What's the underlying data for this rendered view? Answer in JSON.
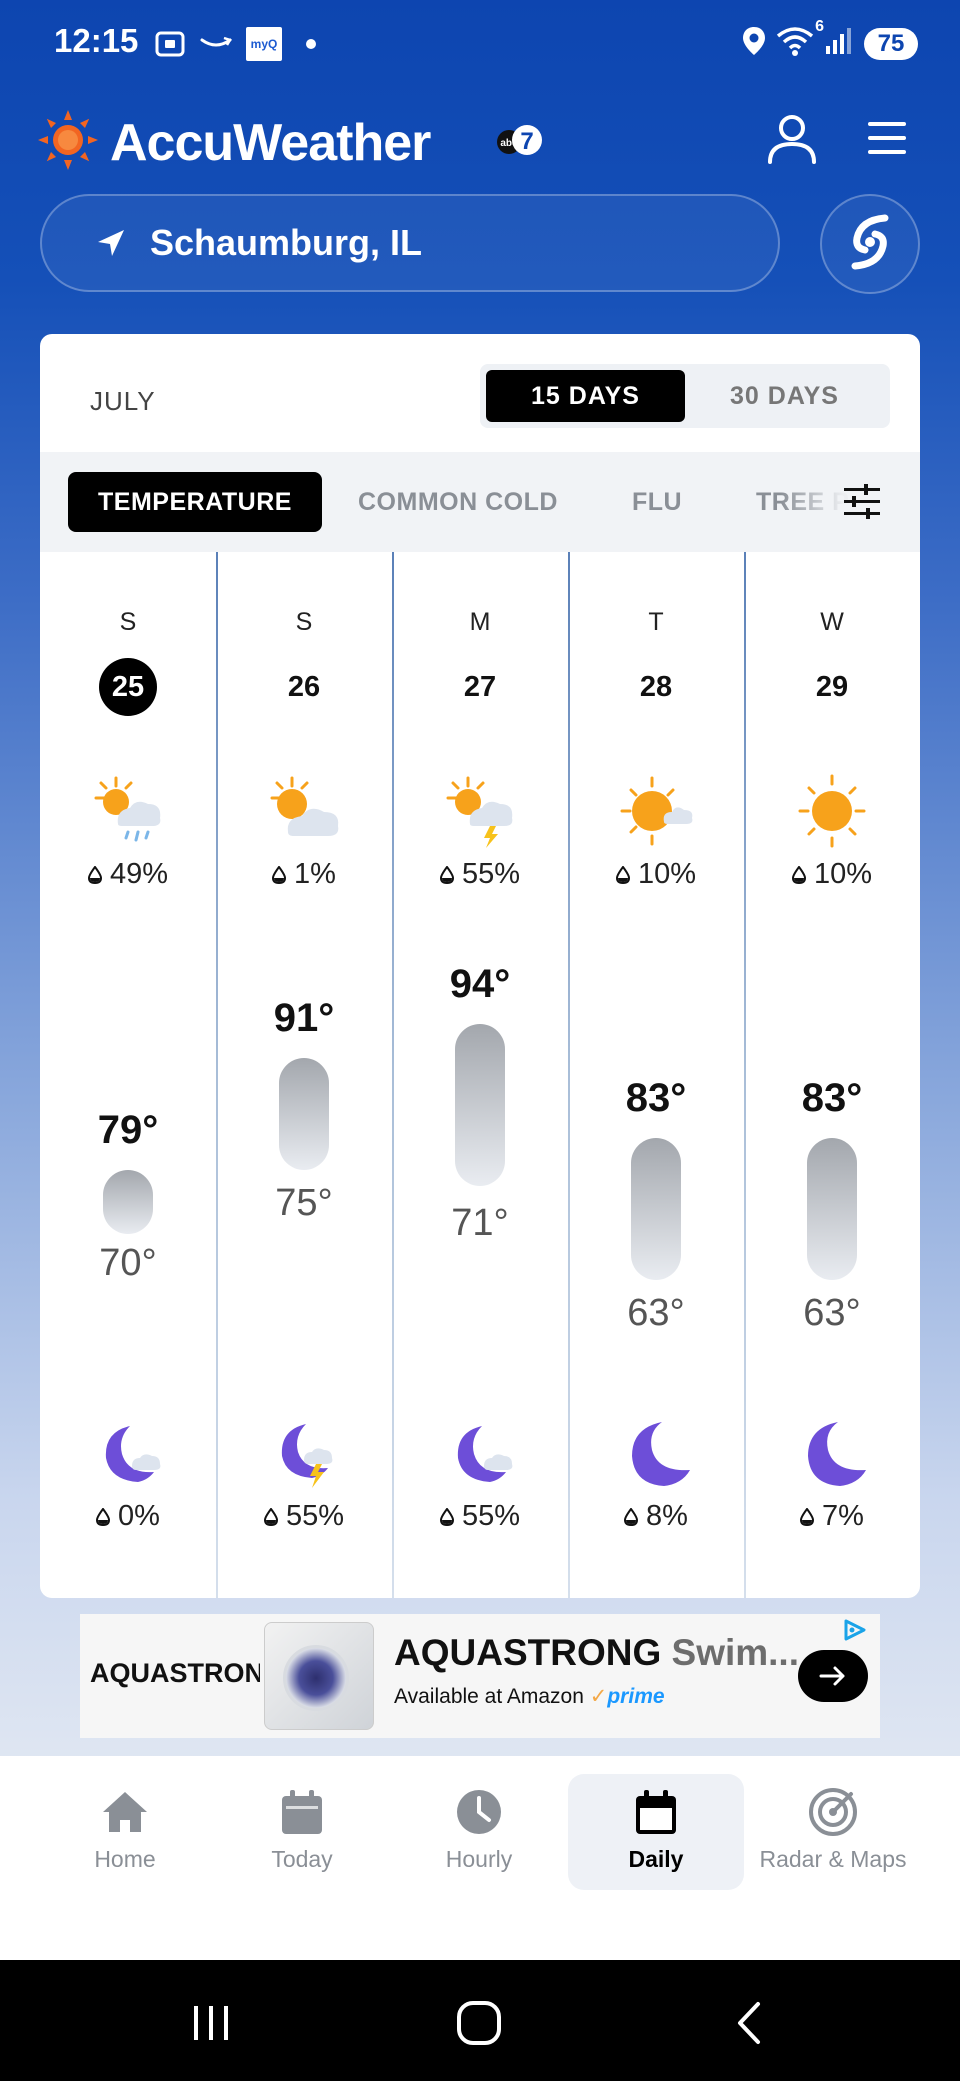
{
  "status_bar": {
    "time": "12:15",
    "myq_label": "myQ",
    "network_superscript": "6",
    "battery": "75"
  },
  "header": {
    "app_name": "AccuWeather",
    "partner_badge": "abc7",
    "brand_color": "#0d45b0",
    "sun_color": "#f26522"
  },
  "location": {
    "name": "Schaumburg, IL"
  },
  "forecast": {
    "month": "JULY",
    "range_options": [
      "15 DAYS",
      "30 DAYS"
    ],
    "selected_range": "15 DAYS",
    "tabs": [
      "TEMPERATURE",
      "COMMON COLD",
      "FLU",
      "TREE P"
    ],
    "selected_tab": "TEMPERATURE",
    "days": [
      {
        "dow": "S",
        "date": "25",
        "today": true,
        "day_icon": "sun-cloud-rain-icon",
        "day_precip": "49%",
        "high": "79°",
        "low": "70°",
        "night_icon": "moon-cloud-icon",
        "night_precip": "0%"
      },
      {
        "dow": "S",
        "date": "26",
        "today": false,
        "day_icon": "sun-cloud-icon",
        "day_precip": "1%",
        "high": "91°",
        "low": "75°",
        "night_icon": "moon-cloud-lightning-icon",
        "night_precip": "55%"
      },
      {
        "dow": "M",
        "date": "27",
        "today": false,
        "day_icon": "sun-cloud-lightning-icon",
        "day_precip": "55%",
        "high": "94°",
        "low": "71°",
        "night_icon": "moon-cloud-icon",
        "night_precip": "55%"
      },
      {
        "dow": "T",
        "date": "28",
        "today": false,
        "day_icon": "sun-small-cloud-icon",
        "day_precip": "10%",
        "high": "83°",
        "low": "63°",
        "night_icon": "moon-icon",
        "night_precip": "8%"
      },
      {
        "dow": "W",
        "date": "29",
        "today": false,
        "day_icon": "sun-icon",
        "day_precip": "10%",
        "high": "83°",
        "low": "63°",
        "night_icon": "moon-icon",
        "night_precip": "7%"
      }
    ]
  },
  "ad": {
    "brand": "AQUASTRONG",
    "title_main": "AQUASTRONG",
    "title_rest": " Swim...",
    "subtitle": "Available at Amazon",
    "prime_check": "✓",
    "prime": "prime"
  },
  "bottom_nav": {
    "items": [
      {
        "label": "Home",
        "icon": "home-icon"
      },
      {
        "label": "Today",
        "icon": "calendar-icon"
      },
      {
        "label": "Hourly",
        "icon": "clock-icon"
      },
      {
        "label": "Daily",
        "icon": "calendar-daily-icon"
      },
      {
        "label": "Radar & Maps",
        "icon": "radar-icon"
      }
    ],
    "selected": "Daily"
  }
}
